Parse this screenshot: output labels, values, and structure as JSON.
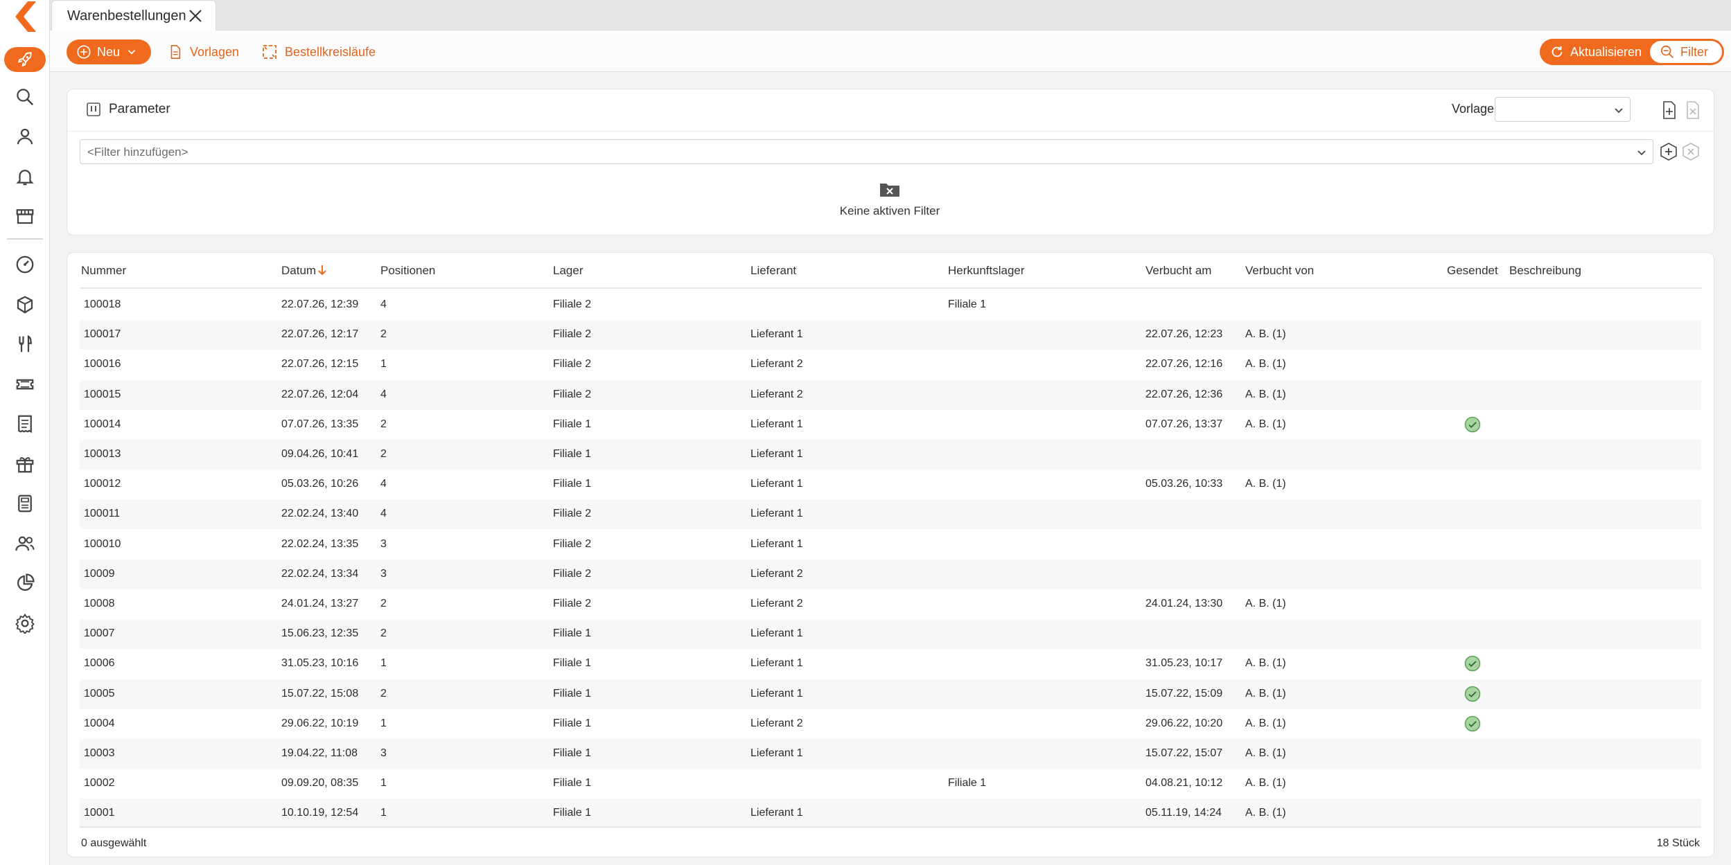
{
  "tab": {
    "title": "Warenbestellungen"
  },
  "toolbar": {
    "new_label": "Neu",
    "templates_label": "Vorlagen",
    "cycles_label": "Bestellkreisläufe",
    "refresh_label": "Aktualisieren",
    "filter_label": "Filter"
  },
  "parameter": {
    "title": "Parameter",
    "vorlage_label": "Vorlage",
    "vorlage_value": "",
    "filter_placeholder": "<Filter hinzufügen>",
    "empty_text": "Keine aktiven Filter"
  },
  "table": {
    "columns": {
      "nummer": "Nummer",
      "datum": "Datum",
      "positionen": "Positionen",
      "lager": "Lager",
      "lieferant": "Lieferant",
      "herkunftslager": "Herkunftslager",
      "verbucht_am": "Verbucht am",
      "verbucht_von": "Verbucht von",
      "gesendet": "Gesendet",
      "beschreibung": "Beschreibung"
    },
    "rows": [
      {
        "nummer": "100018",
        "datum": "22.07.26, 12:39",
        "positionen": "4",
        "lager": "Filiale 2",
        "lieferant": "",
        "herkunftslager": "Filiale 1",
        "verbucht_am": "",
        "verbucht_von": "",
        "gesendet": false
      },
      {
        "nummer": "100017",
        "datum": "22.07.26, 12:17",
        "positionen": "2",
        "lager": "Filiale 2",
        "lieferant": "Lieferant 1",
        "herkunftslager": "",
        "verbucht_am": "22.07.26, 12:23",
        "verbucht_von": "A. B. (1)",
        "gesendet": false
      },
      {
        "nummer": "100016",
        "datum": "22.07.26, 12:15",
        "positionen": "1",
        "lager": "Filiale 2",
        "lieferant": "Lieferant 2",
        "herkunftslager": "",
        "verbucht_am": "22.07.26, 12:16",
        "verbucht_von": "A. B. (1)",
        "gesendet": false
      },
      {
        "nummer": "100015",
        "datum": "22.07.26, 12:04",
        "positionen": "4",
        "lager": "Filiale 2",
        "lieferant": "Lieferant 2",
        "herkunftslager": "",
        "verbucht_am": "22.07.26, 12:36",
        "verbucht_von": "A. B. (1)",
        "gesendet": false
      },
      {
        "nummer": "100014",
        "datum": "07.07.26, 13:35",
        "positionen": "2",
        "lager": "Filiale 1",
        "lieferant": "Lieferant 1",
        "herkunftslager": "",
        "verbucht_am": "07.07.26, 13:37",
        "verbucht_von": "A. B. (1)",
        "gesendet": true
      },
      {
        "nummer": "100013",
        "datum": "09.04.26, 10:41",
        "positionen": "2",
        "lager": "Filiale 1",
        "lieferant": "Lieferant 1",
        "herkunftslager": "",
        "verbucht_am": "",
        "verbucht_von": "",
        "gesendet": false
      },
      {
        "nummer": "100012",
        "datum": "05.03.26, 10:26",
        "positionen": "4",
        "lager": "Filiale 1",
        "lieferant": "Lieferant 1",
        "herkunftslager": "",
        "verbucht_am": "05.03.26, 10:33",
        "verbucht_von": "A. B. (1)",
        "gesendet": false
      },
      {
        "nummer": "100011",
        "datum": "22.02.24, 13:40",
        "positionen": "4",
        "lager": "Filiale 2",
        "lieferant": "Lieferant 1",
        "herkunftslager": "",
        "verbucht_am": "",
        "verbucht_von": "",
        "gesendet": false
      },
      {
        "nummer": "100010",
        "datum": "22.02.24, 13:35",
        "positionen": "3",
        "lager": "Filiale 2",
        "lieferant": "Lieferant 1",
        "herkunftslager": "",
        "verbucht_am": "",
        "verbucht_von": "",
        "gesendet": false
      },
      {
        "nummer": "10009",
        "datum": "22.02.24, 13:34",
        "positionen": "3",
        "lager": "Filiale 2",
        "lieferant": "Lieferant 2",
        "herkunftslager": "",
        "verbucht_am": "",
        "verbucht_von": "",
        "gesendet": false
      },
      {
        "nummer": "10008",
        "datum": "24.01.24, 13:27",
        "positionen": "2",
        "lager": "Filiale 2",
        "lieferant": "Lieferant 2",
        "herkunftslager": "",
        "verbucht_am": "24.01.24, 13:30",
        "verbucht_von": "A. B. (1)",
        "gesendet": false
      },
      {
        "nummer": "10007",
        "datum": "15.06.23, 12:35",
        "positionen": "2",
        "lager": "Filiale 1",
        "lieferant": "Lieferant 1",
        "herkunftslager": "",
        "verbucht_am": "",
        "verbucht_von": "",
        "gesendet": false
      },
      {
        "nummer": "10006",
        "datum": "31.05.23, 10:16",
        "positionen": "1",
        "lager": "Filiale 1",
        "lieferant": "Lieferant 1",
        "herkunftslager": "",
        "verbucht_am": "31.05.23, 10:17",
        "verbucht_von": "A. B. (1)",
        "gesendet": true
      },
      {
        "nummer": "10005",
        "datum": "15.07.22, 15:08",
        "positionen": "2",
        "lager": "Filiale 1",
        "lieferant": "Lieferant 1",
        "herkunftslager": "",
        "verbucht_am": "15.07.22, 15:09",
        "verbucht_von": "A. B. (1)",
        "gesendet": true
      },
      {
        "nummer": "10004",
        "datum": "29.06.22, 10:19",
        "positionen": "1",
        "lager": "Filiale 1",
        "lieferant": "Lieferant 2",
        "herkunftslager": "",
        "verbucht_am": "29.06.22, 10:20",
        "verbucht_von": "A. B. (1)",
        "gesendet": true
      },
      {
        "nummer": "10003",
        "datum": "19.04.22, 11:08",
        "positionen": "3",
        "lager": "Filiale 1",
        "lieferant": "Lieferant 1",
        "herkunftslager": "",
        "verbucht_am": "15.07.22, 15:07",
        "verbucht_von": "A. B. (1)",
        "gesendet": false
      },
      {
        "nummer": "10002",
        "datum": "09.09.20, 08:35",
        "positionen": "1",
        "lager": "Filiale 1",
        "lieferant": "",
        "herkunftslager": "Filiale 1",
        "verbucht_am": "04.08.21, 10:12",
        "verbucht_von": "A. B. (1)",
        "gesendet": false
      },
      {
        "nummer": "10001",
        "datum": "10.10.19, 12:54",
        "positionen": "1",
        "lager": "Filiale 1",
        "lieferant": "Lieferant 1",
        "herkunftslager": "",
        "verbucht_am": "05.11.19, 14:24",
        "verbucht_von": "A. B. (1)",
        "gesendet": false
      }
    ],
    "footer": {
      "selected": "0 ausgewählt",
      "count": "18 Stück"
    }
  },
  "colors": {
    "accent": "#f06a1d",
    "check": "#5aa05a"
  },
  "sidebar_icons": [
    "rocket-icon",
    "search-icon",
    "user-icon",
    "bell-icon",
    "store-icon",
    "gauge-icon",
    "boxes-icon",
    "cutlery-icon",
    "ticket-icon",
    "receipt-icon",
    "gift-icon",
    "register-icon",
    "users-icon",
    "pie-chart-icon",
    "gear-icon"
  ]
}
